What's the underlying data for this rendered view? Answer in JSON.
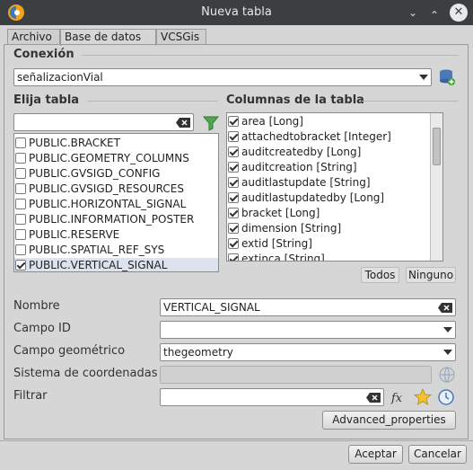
{
  "window": {
    "title": "Nueva tabla",
    "icons": {
      "logo": "gvsig-logo-icon",
      "minimize": "chevron-down-icon",
      "maximize": "chevron-up-icon",
      "close": "close-icon"
    }
  },
  "tabs": [
    "Archivo",
    "Base de datos",
    "VCSGis"
  ],
  "connection": {
    "label": "Conexión",
    "value": "señalizacionVial"
  },
  "tables": {
    "label": "Elija tabla",
    "filter": "",
    "items": [
      {
        "name": "PUBLIC.BRACKET",
        "checked": false
      },
      {
        "name": "PUBLIC.GEOMETRY_COLUMNS",
        "checked": false
      },
      {
        "name": "PUBLIC.GVSIGD_CONFIG",
        "checked": false
      },
      {
        "name": "PUBLIC.GVSIGD_RESOURCES",
        "checked": false
      },
      {
        "name": "PUBLIC.HORIZONTAL_SIGNAL",
        "checked": false
      },
      {
        "name": "PUBLIC.INFORMATION_POSTER",
        "checked": false
      },
      {
        "name": "PUBLIC.RESERVE",
        "checked": false
      },
      {
        "name": "PUBLIC.SPATIAL_REF_SYS",
        "checked": false
      },
      {
        "name": "PUBLIC.VERTICAL_SIGNAL",
        "checked": true
      }
    ]
  },
  "columns": {
    "label": "Columnas de la tabla",
    "items": [
      {
        "name": "area [Long]",
        "checked": true
      },
      {
        "name": "attachedtobracket [Integer]",
        "checked": true
      },
      {
        "name": "auditcreatedby [Long]",
        "checked": true
      },
      {
        "name": "auditcreation [String]",
        "checked": true
      },
      {
        "name": "auditlastupdate [String]",
        "checked": true
      },
      {
        "name": "auditlastupdatedby [Long]",
        "checked": true
      },
      {
        "name": "bracket [Long]",
        "checked": true
      },
      {
        "name": "dimension [String]",
        "checked": true
      },
      {
        "name": "extid [String]",
        "checked": true
      },
      {
        "name": "extinca [String]",
        "checked": true
      }
    ],
    "all_label": "Todos",
    "none_label": "Ninguno"
  },
  "form": {
    "name_label": "Nombre",
    "name_value": "VERTICAL_SIGNAL",
    "id_label": "Campo ID",
    "id_value": "",
    "geom_label": "Campo geométrico",
    "geom_value": "thegeometry",
    "crs_label": "Sistema de coordenadas",
    "crs_value": "",
    "filter_label": "Filtrar",
    "filter_value": "",
    "advanced_label": "Advanced_properties"
  },
  "buttons": {
    "accept": "Aceptar",
    "cancel": "Cancelar"
  }
}
